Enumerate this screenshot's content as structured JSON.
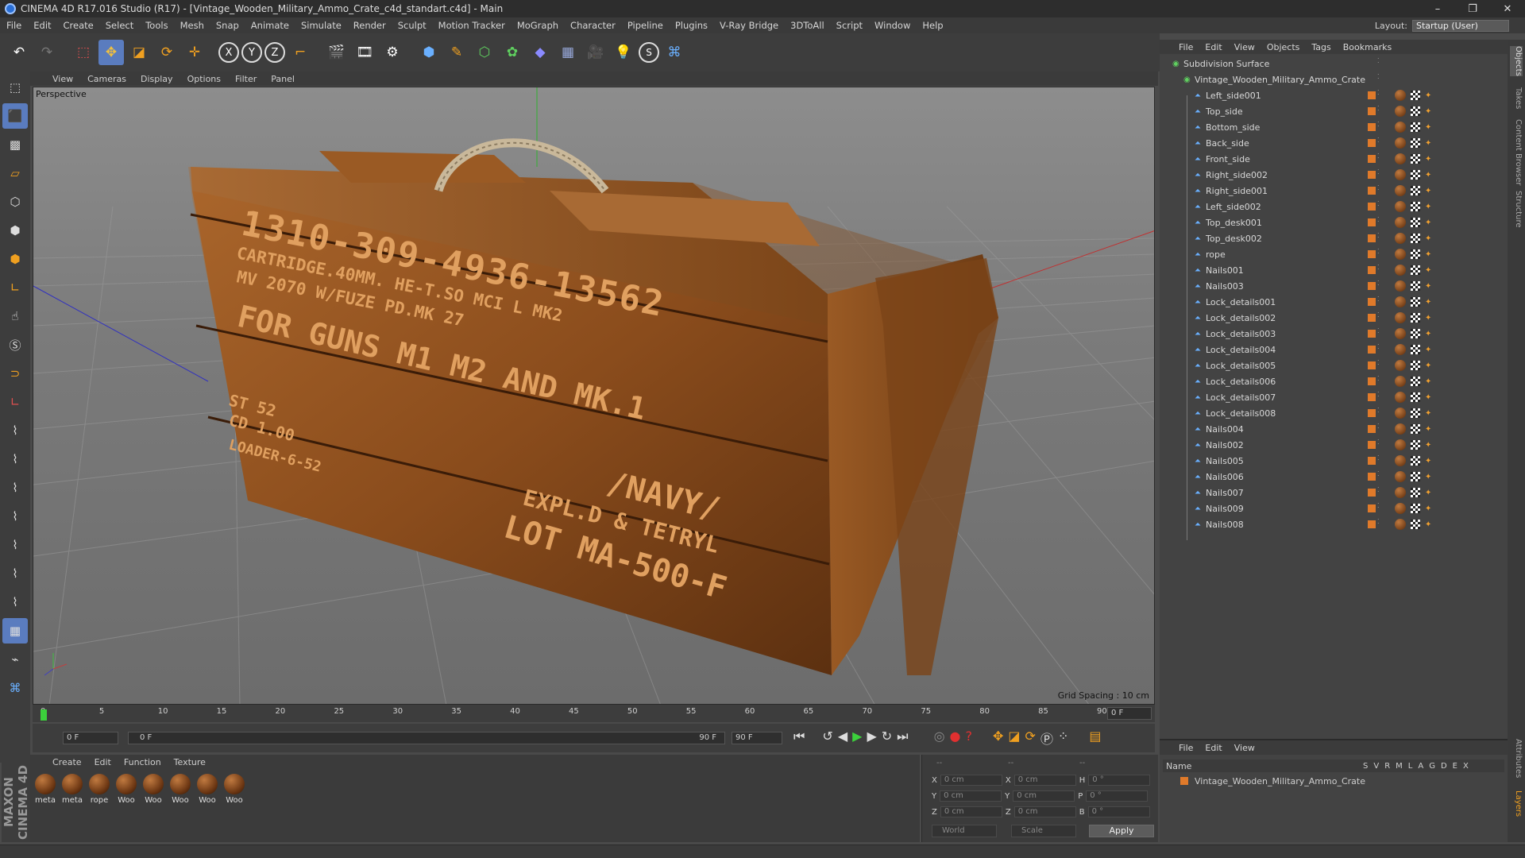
{
  "window": {
    "title": "CINEMA 4D R17.016 Studio (R17) - [Vintage_Wooden_Military_Ammo_Crate_c4d_standart.c4d] - Main",
    "controls": [
      "–",
      "❐",
      "✕"
    ]
  },
  "menubar": [
    "File",
    "Edit",
    "Create",
    "Select",
    "Tools",
    "Mesh",
    "Snap",
    "Animate",
    "Simulate",
    "Render",
    "Sculpt",
    "Motion Tracker",
    "MoGraph",
    "Character",
    "Pipeline",
    "Plugins",
    "V-Ray Bridge",
    "3DToAll",
    "Script",
    "Window",
    "Help"
  ],
  "layout": {
    "label": "Layout:",
    "value": "Startup (User)"
  },
  "viewport": {
    "menu": [
      "View",
      "Cameras",
      "Display",
      "Options",
      "Filter",
      "Panel"
    ],
    "camera_label": "Perspective",
    "grid_spacing": "Grid Spacing : 10 cm",
    "crate_text": [
      "1310-309-4936-13562",
      "CARTRIDGE.40MM. HE-T.SO MCI L MK2",
      "MV 2070 W/FUZE PD.MK 27",
      "FOR GUNS M1 M2 AND MK.1",
      "/NAVY/",
      "EXPL.D & TETRYL",
      "LOT MA-500-F",
      "ST 52",
      "CD 1.00",
      "LOADER-6-52"
    ]
  },
  "timeline": {
    "ticks": [
      "0",
      "5",
      "10",
      "15",
      "20",
      "25",
      "30",
      "35",
      "40",
      "45",
      "50",
      "55",
      "60",
      "65",
      "70",
      "75",
      "80",
      "85",
      "90"
    ],
    "current_frame_right": "0 F",
    "start_field": "0 F",
    "range_start": "0 F",
    "range_end": "90 F",
    "end_field": "90 F"
  },
  "materials": {
    "menu": [
      "Create",
      "Edit",
      "Function",
      "Texture"
    ],
    "items": [
      "meta",
      "meta",
      "rope",
      "Woo",
      "Woo",
      "Woo",
      "Woo",
      "Woo"
    ]
  },
  "coordinates": {
    "header_left": "--",
    "header_mid": "--",
    "header_right": "--",
    "rows": [
      {
        "a": "X",
        "av": "0 cm",
        "b": "X",
        "bv": "0 cm",
        "c": "H",
        "cv": "0 °"
      },
      {
        "a": "Y",
        "av": "0 cm",
        "b": "Y",
        "bv": "0 cm",
        "c": "P",
        "cv": "0 °"
      },
      {
        "a": "Z",
        "av": "0 cm",
        "b": "Z",
        "bv": "0 cm",
        "c": "B",
        "cv": "0 °"
      }
    ],
    "mode": "World",
    "type": "Scale",
    "apply": "Apply"
  },
  "objects": {
    "menu": [
      "File",
      "Edit",
      "View",
      "Objects",
      "Tags",
      "Bookmarks"
    ],
    "root": "Subdivision Surface",
    "group": "Vintage_Wooden_Military_Ammo_Crate",
    "children": [
      "Left_side001",
      "Top_side",
      "Bottom_side",
      "Back_side",
      "Front_side",
      "Right_side002",
      "Right_side001",
      "Left_side002",
      "Top_desk001",
      "Top_desk002",
      "rope",
      "Nails001",
      "Nails003",
      "Lock_details001",
      "Lock_details002",
      "Lock_details003",
      "Lock_details004",
      "Lock_details005",
      "Lock_details006",
      "Lock_details007",
      "Lock_details008",
      "Nails004",
      "Nails002",
      "Nails005",
      "Nails006",
      "Nails007",
      "Nails009",
      "Nails008"
    ]
  },
  "layers": {
    "menu": [
      "File",
      "Edit",
      "View"
    ],
    "header_name": "Name",
    "header_cols": [
      "S",
      "V",
      "R",
      "M",
      "L",
      "A",
      "G",
      "D",
      "E",
      "X"
    ],
    "row": "Vintage_Wooden_Military_Ammo_Crate"
  },
  "sidetabs": [
    "Objects",
    "Takes",
    "Content Browser",
    "Structure",
    "Attributes",
    "Layers"
  ],
  "brand": "MAXON CINEMA 4D"
}
